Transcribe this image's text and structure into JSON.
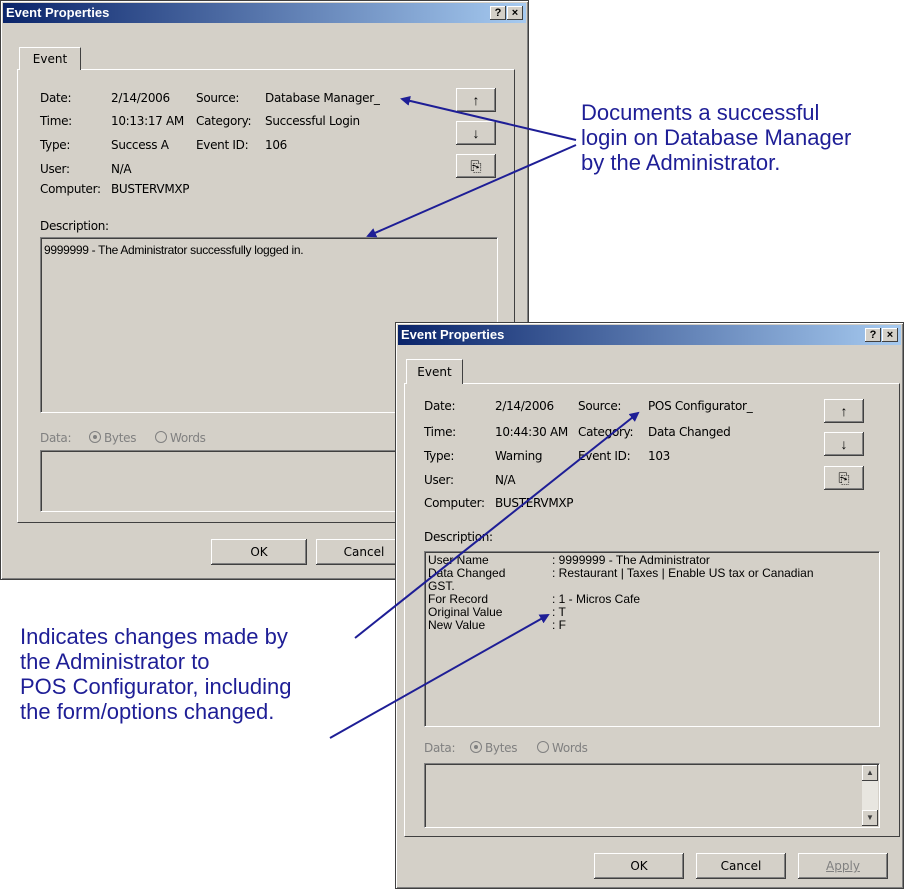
{
  "dialog1": {
    "title": "Event Properties",
    "help_btn": "?",
    "close_btn": "×",
    "tab": "Event",
    "labels": {
      "date": "Date:",
      "time": "Time:",
      "type": "Type:",
      "user": "User:",
      "computer": "Computer:",
      "source": "Source:",
      "category": "Category:",
      "event_id": "Event ID:"
    },
    "values": {
      "date": "2/14/2006",
      "time": "10:13:17 AM",
      "type": "Success A",
      "user": "N/A",
      "computer": "BUSTERVMXP",
      "source": "Database Manager_",
      "category": "Successful Login",
      "event_id": "106"
    },
    "description_label": "Description:",
    "description_text": "9999999 - The Administrator successfully logged in.",
    "data_label": "Data:",
    "radio_bytes": "Bytes",
    "radio_words": "Words",
    "ok": "OK",
    "cancel": "Cancel",
    "up_icon": "↑",
    "down_icon": "↓",
    "copy_icon": "⎘"
  },
  "dialog2": {
    "title": "Event Properties",
    "help_btn": "?",
    "close_btn": "×",
    "tab": "Event",
    "labels": {
      "date": "Date:",
      "time": "Time:",
      "type": "Type:",
      "user": "User:",
      "computer": "Computer:",
      "source": "Source:",
      "category": "Category:",
      "event_id": "Event ID:"
    },
    "values": {
      "date": "2/14/2006",
      "time": "10:44:30 AM",
      "type": "Warning",
      "user": "N/A",
      "computer": "BUSTERVMXP",
      "source": "POS Configurator_",
      "category": "Data Changed",
      "event_id": "103"
    },
    "description_label": "Description:",
    "description_rows": [
      {
        "key": "User Name",
        "value": ": 9999999 - The Administrator"
      },
      {
        "key": "Data Changed",
        "value": ": Restaurant | Taxes | Enable US tax or Canadian"
      },
      {
        "key": "GST.",
        "value": ""
      },
      {
        "key": "For Record",
        "value": ": 1 - Micros Cafe"
      },
      {
        "key": "Original Value",
        "value": ": T"
      },
      {
        "key": "New Value",
        "value": ": F"
      }
    ],
    "data_label": "Data:",
    "radio_bytes": "Bytes",
    "radio_words": "Words",
    "ok": "OK",
    "cancel": "Cancel",
    "apply": "Apply",
    "up_icon": "↑",
    "down_icon": "↓",
    "copy_icon": "⎘"
  },
  "annotations": {
    "top": [
      "Documents a successful",
      "login on Database Manager",
      "by the Administrator."
    ],
    "bottom": [
      "Indicates changes made by",
      "the Administrator to",
      "POS Configurator, including",
      "the form/options changed."
    ]
  },
  "colors": {
    "annotation": "#1e1e96",
    "titlebar_start": "#0a246a",
    "titlebar_end": "#a6caf0",
    "dialog_face": "#d4d0c8"
  }
}
